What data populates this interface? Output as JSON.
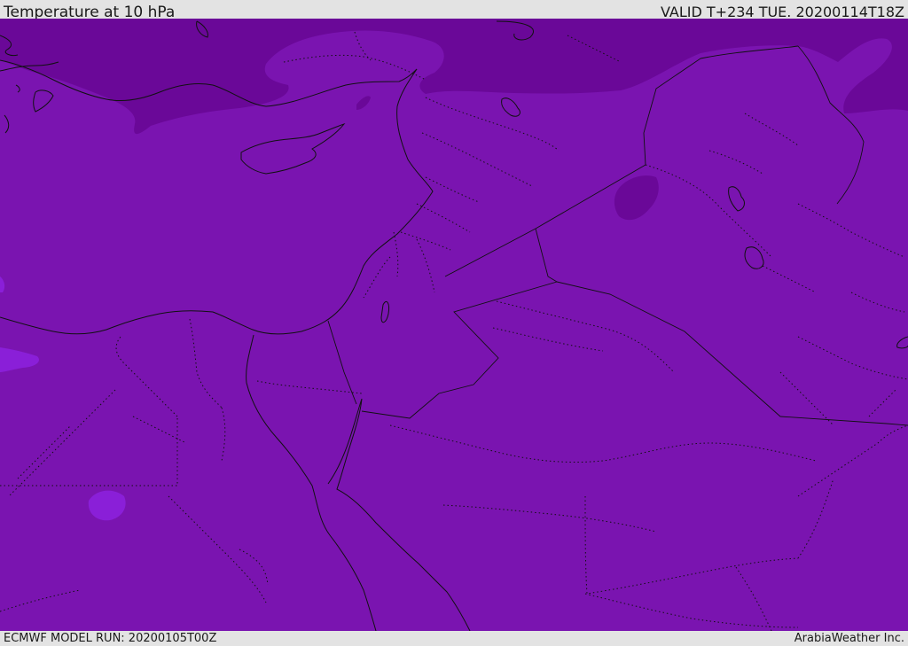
{
  "header": {
    "title": "Temperature at 10 hPa",
    "valid": "VALID T+234 TUE. 20200114T18Z"
  },
  "footer": {
    "model_run": "ECMWF MODEL RUN: 20200105T00Z",
    "credit": "ArabiaWeather Inc."
  },
  "map": {
    "colors": {
      "background_field": "#7a14b0",
      "cold_field": "#6a0898",
      "warm_patch": "#8a1fd8",
      "coastline": "#111111"
    }
  }
}
